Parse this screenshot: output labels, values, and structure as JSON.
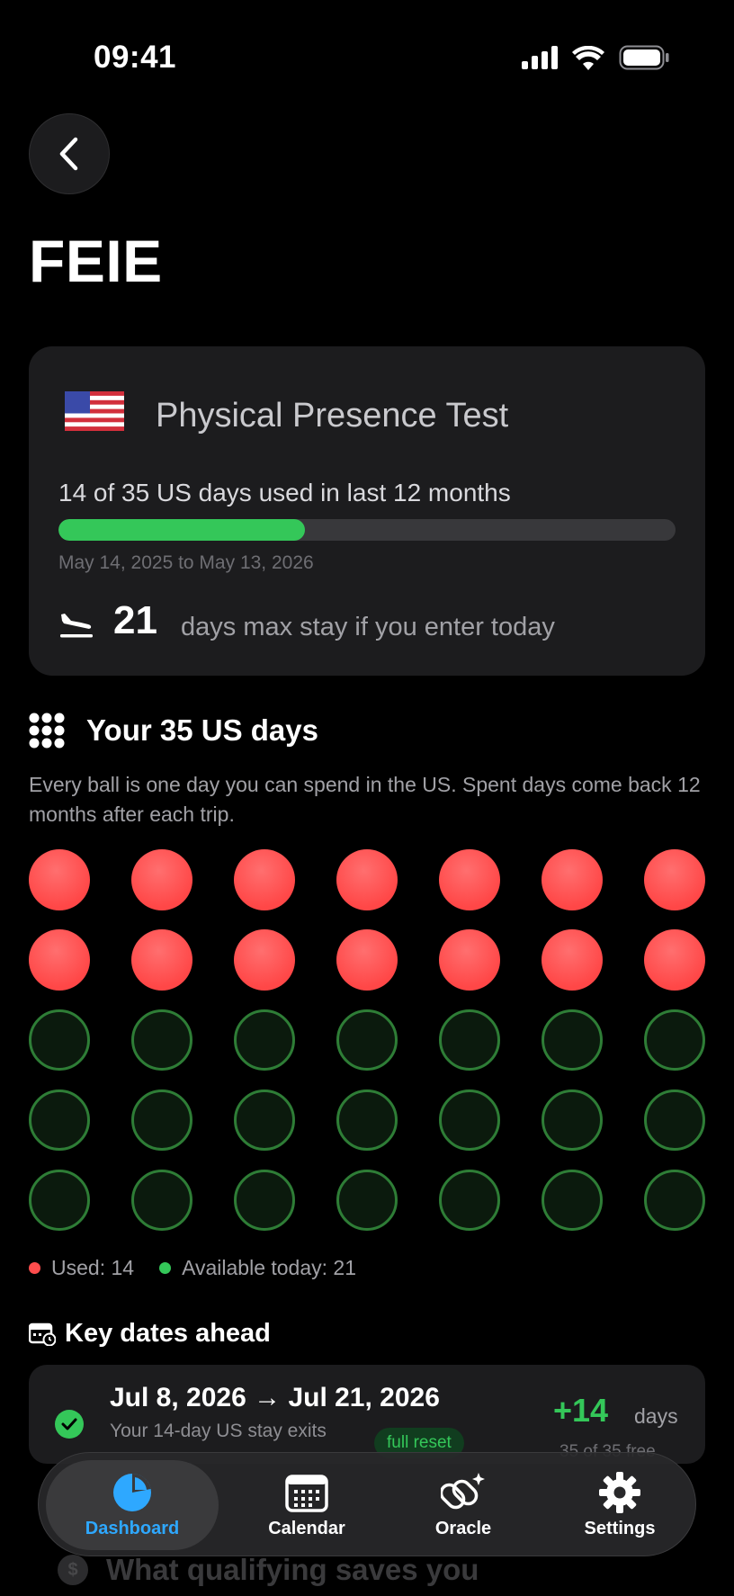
{
  "status_bar": {
    "time": "09:41"
  },
  "page": {
    "title": "FEIE"
  },
  "presence_card": {
    "title": "Physical Presence Test",
    "usage_text": "14 of 35 US days used in last 12 months",
    "progress_fraction": 0.4,
    "range_text": "May 14, 2025 to May 13, 2026",
    "max_number": "21",
    "max_text": "days max stay if you enter today"
  },
  "days_section": {
    "title": "Your 35 US days",
    "description": "Every ball is one day you can spend in the US. Spent days come back 12 months after each trip.",
    "total": 35,
    "used": 14,
    "legend_used": "Used: 14",
    "legend_available": "Available today: 21",
    "colors": {
      "used": "#ff4d4d",
      "available": "#34c759"
    }
  },
  "key_dates": {
    "title": "Key dates ahead",
    "items": [
      {
        "range": "Jul 8, 2026 → Jul 21, 2026",
        "subtitle": "Your 14-day US stay exits",
        "badge": "full reset",
        "delta": "+14",
        "unit": "days",
        "free": "35 of 35 free"
      }
    ]
  },
  "next_section": {
    "title": "What qualifying saves you",
    "icon": "$"
  },
  "tab_bar": {
    "tabs": [
      {
        "label": "Dashboard",
        "icon": "pie-chart-icon"
      },
      {
        "label": "Calendar",
        "icon": "calendar-icon"
      },
      {
        "label": "Oracle",
        "icon": "sparkle-link-icon"
      },
      {
        "label": "Settings",
        "icon": "gear-icon"
      }
    ],
    "active_color": "#2ea8ff"
  }
}
